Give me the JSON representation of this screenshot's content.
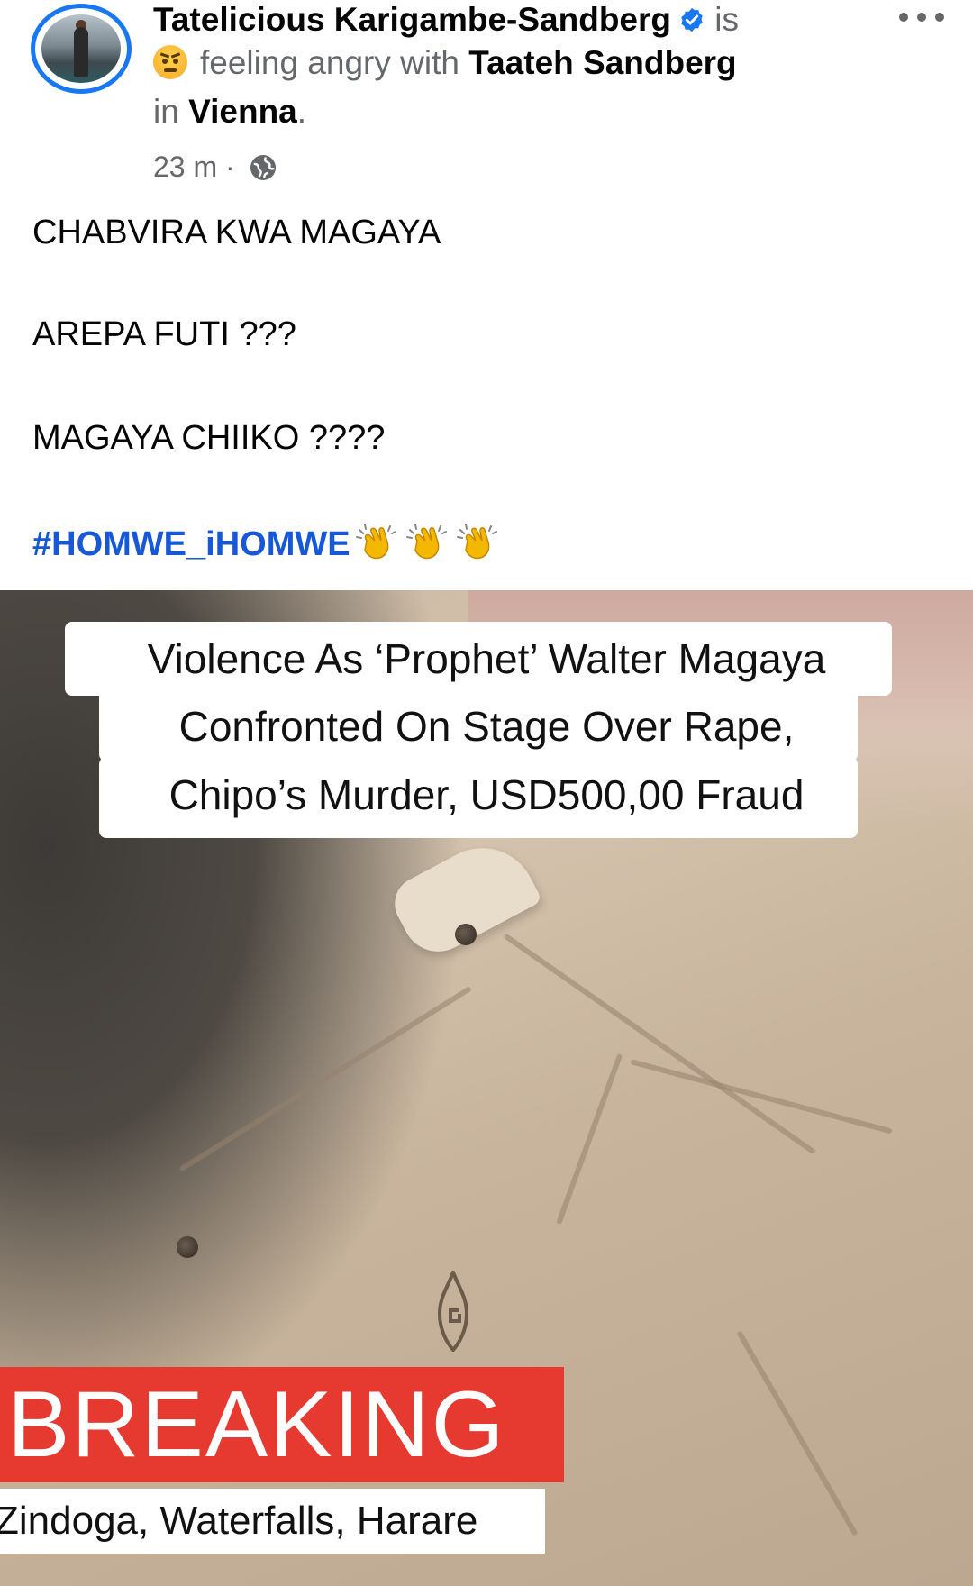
{
  "post": {
    "author": "Tatelicious Karigambe-Sandberg",
    "is_text": "is",
    "feeling_text": "feeling angry with",
    "with_name": "Taateh Sandberg",
    "in_text": "in",
    "place": "Vienna",
    "place_suffix": ".",
    "time": "23 m",
    "time_sep": "·",
    "icons": {
      "verified": "verified-badge-icon",
      "feeling": "angry-face-icon",
      "privacy": "globe-icon",
      "more": "more-options-icon",
      "clap": "clapping-hands-icon"
    },
    "accent_color": "#1877f2",
    "hashtag_color": "#1658d6",
    "body": {
      "line1": "CHABVIRA KWA MAGAYA",
      "line2": "AREPA FUTI ???",
      "line3": "MAGAYA CHIIKO ????",
      "hashtag": "#HOMWE_iHOMWE"
    }
  },
  "media": {
    "headline_line1": "Violence As ‘Prophet’ Walter Magaya",
    "headline_line2": "Confronted On Stage Over Rape,",
    "headline_line3": "Chipo’s Murder, USD500,00 Fraud",
    "breaking_label": "BREAKING",
    "location": "Zindoga, Waterfalls, Harare",
    "breaking_color": "#e6392f"
  }
}
